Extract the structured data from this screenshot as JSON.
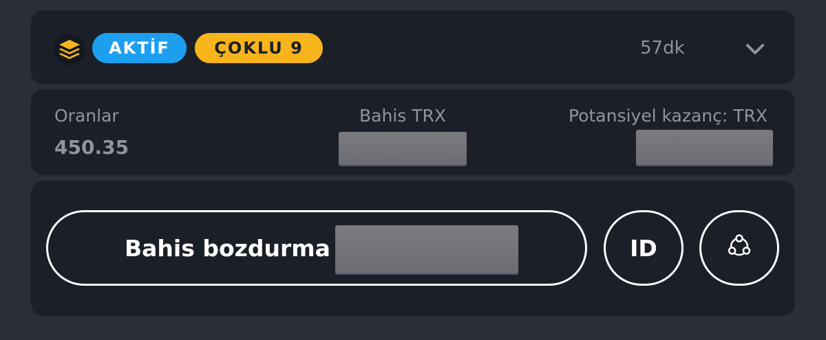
{
  "header": {
    "status_badge": "AKTİF",
    "type_badge": "ÇOKLU 9",
    "elapsed": "57dk"
  },
  "summary": {
    "odds_label": "Oranlar",
    "odds_value": "450.35",
    "bet_label": "Bahis TRX",
    "potential_label": "Potansiyel kazanç: TRX"
  },
  "actions": {
    "cashout_label": "Bahis bozdurma",
    "id_label": "ID"
  },
  "colors": {
    "active_badge": "#1d9ff0",
    "multi_badge": "#f8b51b",
    "card_bg": "#1b2028",
    "page_bg": "#2a2f37"
  },
  "icons": {
    "bet_type": "layers-icon",
    "expand": "chevron-down-icon",
    "share": "share-icon"
  }
}
